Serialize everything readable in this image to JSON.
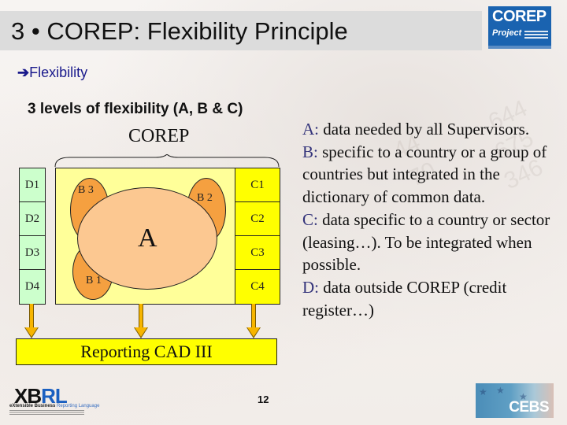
{
  "slide": {
    "title": "3 • COREP: Flexibility Principle",
    "bullet_icon": "➔",
    "bullet_text": "Flexibility",
    "subheading": "3 levels of flexibility (A, B & C)",
    "page_number": "12"
  },
  "logos": {
    "corep_line1": "COREP",
    "corep_line2": "Project",
    "xbrl_part1": "XB",
    "xbrl_part2": "RL",
    "xbrl_sub1": "eXtensible Business",
    "xbrl_sub2": "Reporting Language",
    "cebs": "CEBS"
  },
  "watermark_numbers": [
    "644",
    "675",
    "346",
    "44",
    "70"
  ],
  "diagram": {
    "brace_label": "COREP",
    "d_cells": [
      "D1",
      "D2",
      "D3",
      "D4"
    ],
    "c_cells": [
      "C1",
      "C2",
      "C3",
      "C4"
    ],
    "b_blobs": [
      "B 3",
      "B 2",
      "B 1"
    ],
    "core_label": "A",
    "reporting_label": "Reporting CAD III",
    "colors": {
      "d_fill": "#ccffcc",
      "main_fill": "#ffff99",
      "c_fill": "#ffff00",
      "b_fill": "#f5a040",
      "a_fill": "#fcc891",
      "arrow_fill": "#f7b500",
      "reporting_fill": "#ffff00"
    }
  },
  "legend": [
    {
      "key": "A:",
      "text": " data needed by all Supervisors."
    },
    {
      "key": "B:",
      "text": " specific to a country or a group of countries but integrated in the dictionary of common data."
    },
    {
      "key": "C:",
      "text": " data specific to a country or sector (leasing…). To be integrated when possible."
    },
    {
      "key": "D:",
      "text": " data outside COREP (credit register…)"
    }
  ]
}
